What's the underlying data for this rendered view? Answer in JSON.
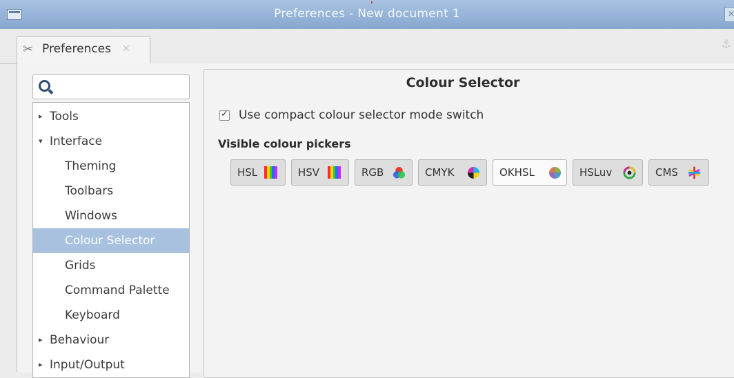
{
  "window": {
    "title": "Preferences - New document 1",
    "close_glyph": "✕"
  },
  "tab": {
    "icon": "✂",
    "label": "Preferences",
    "close_glyph": "✕",
    "pin_glyph": "⚓"
  },
  "search": {
    "value": "",
    "placeholder": ""
  },
  "tree": {
    "items": [
      {
        "label": "Tools",
        "level": 0,
        "expanded": false
      },
      {
        "label": "Interface",
        "level": 0,
        "expanded": true
      },
      {
        "label": "Theming",
        "level": 1
      },
      {
        "label": "Toolbars",
        "level": 1
      },
      {
        "label": "Windows",
        "level": 1
      },
      {
        "label": "Colour Selector",
        "level": 1,
        "selected": true
      },
      {
        "label": "Grids",
        "level": 1
      },
      {
        "label": "Command Palette",
        "level": 1
      },
      {
        "label": "Keyboard",
        "level": 1
      },
      {
        "label": "Behaviour",
        "level": 0,
        "expanded": false
      },
      {
        "label": "Input/Output",
        "level": 0,
        "expanded": false
      }
    ],
    "collapsed_arrow": "▸",
    "expanded_arrow": "▾"
  },
  "panel": {
    "title": "Colour Selector",
    "compact_switch": {
      "label": "Use compact colour selector mode switch",
      "checked": true
    },
    "pickers_heading": "Visible colour pickers",
    "pickers": [
      {
        "label": "HSL",
        "icon": "hsl-bars-icon",
        "active": false
      },
      {
        "label": "HSV",
        "icon": "hsv-bars-icon",
        "active": false
      },
      {
        "label": "RGB",
        "icon": "rgb-circles-icon",
        "active": false
      },
      {
        "label": "CMYK",
        "icon": "cmyk-wheel-icon",
        "active": false
      },
      {
        "label": "OKHSL",
        "icon": "okhsl-disc-icon",
        "active": true
      },
      {
        "label": "HSLuv",
        "icon": "hsluv-ring-icon",
        "active": false
      },
      {
        "label": "CMS",
        "icon": "cms-star-icon",
        "active": false
      }
    ]
  },
  "colors": {
    "titlebar": "#8fb0d8",
    "selection": "#a8c1df"
  }
}
